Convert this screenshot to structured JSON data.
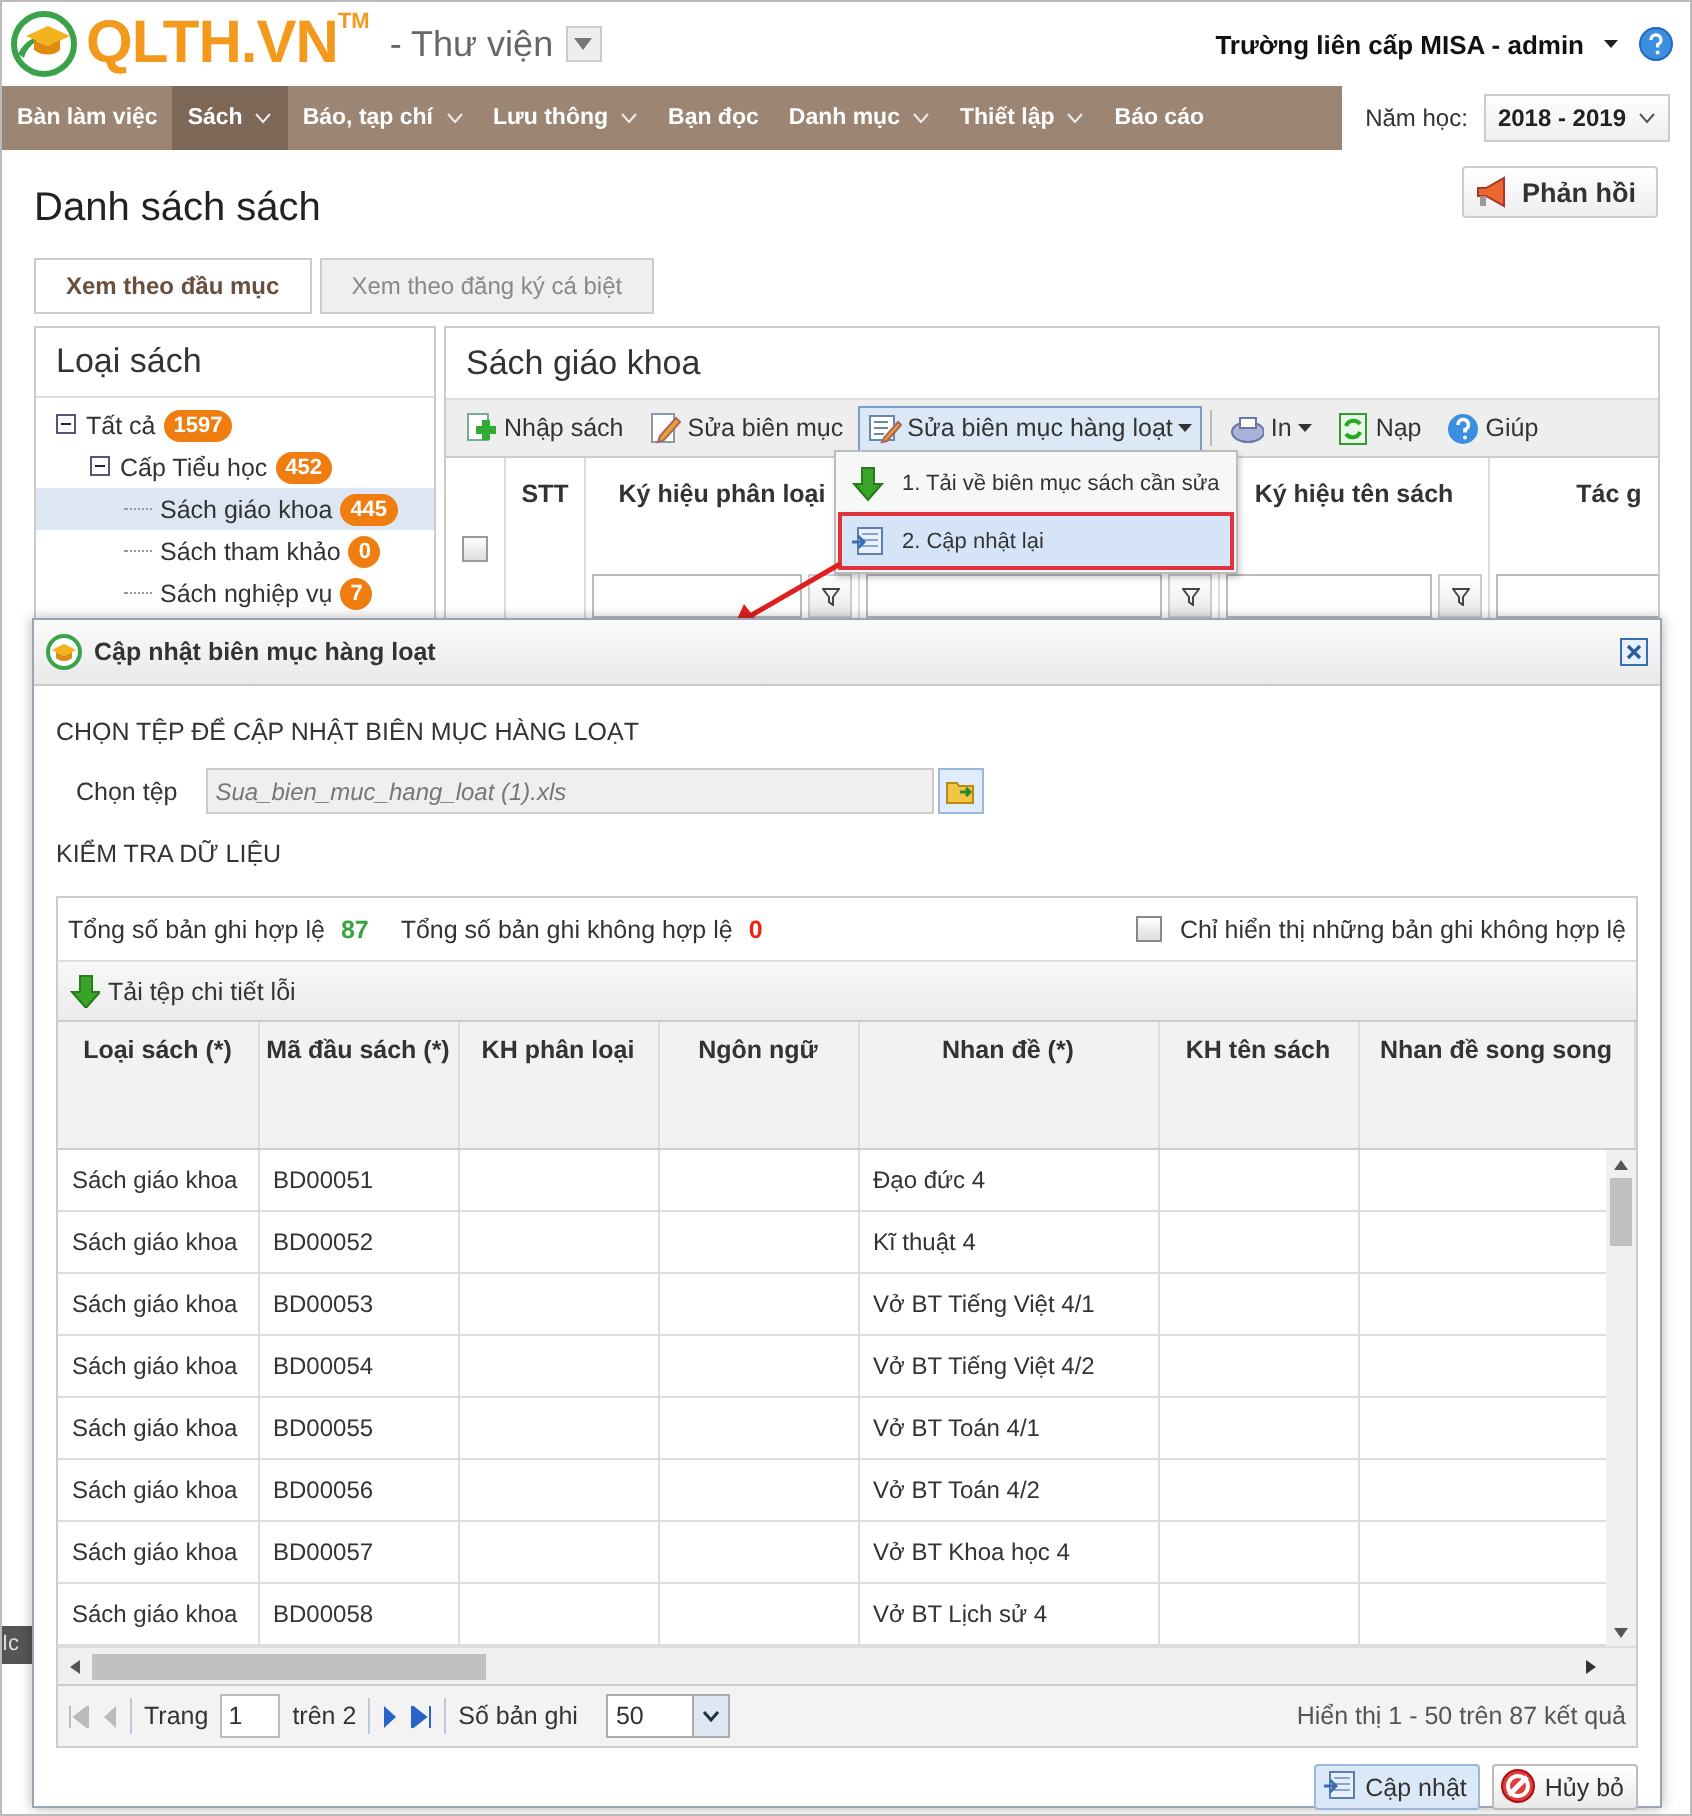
{
  "app": {
    "logo": "QLTH.VN",
    "trademark": "TM",
    "module": "- Thư viện",
    "user": "Trường liên cấp MISA - admin"
  },
  "nav": [
    {
      "label": "Bàn làm việc",
      "has_menu": false,
      "selected": false
    },
    {
      "label": "Sách",
      "has_menu": true,
      "selected": true
    },
    {
      "label": "Báo, tạp chí",
      "has_menu": true,
      "selected": false
    },
    {
      "label": "Lưu thông",
      "has_menu": true,
      "selected": false
    },
    {
      "label": "Bạn đọc",
      "has_menu": false,
      "selected": false
    },
    {
      "label": "Danh mục",
      "has_menu": true,
      "selected": false
    },
    {
      "label": "Thiết lập",
      "has_menu": true,
      "selected": false
    },
    {
      "label": "Báo cáo",
      "has_menu": false,
      "selected": false
    }
  ],
  "school_year": {
    "label": "Năm học:",
    "value": "2018 - 2019"
  },
  "page_title": "Danh sách sách",
  "feedback_button": "Phản hồi",
  "view_tabs": [
    {
      "label": "Xem theo đầu mục",
      "selected": true
    },
    {
      "label": "Xem theo đăng ký cá biệt",
      "selected": false
    }
  ],
  "category_panel": {
    "title": "Loại sách",
    "tree": [
      {
        "label": "Tất cả",
        "count": "1597",
        "expanded": true,
        "selected": false,
        "children": [
          {
            "label": "Cấp Tiểu học",
            "count": "452",
            "expanded": true,
            "selected": false,
            "children": [
              {
                "label": "Sách giáo khoa",
                "count": "445",
                "selected": true
              },
              {
                "label": "Sách tham khảo",
                "count": "0",
                "selected": false
              },
              {
                "label": "Sách nghiệp vụ",
                "count": "7",
                "selected": false
              }
            ]
          }
        ]
      }
    ]
  },
  "books_panel": {
    "title": "Sách giáo khoa",
    "toolbar": [
      {
        "kind": "import",
        "label": "Nhập sách",
        "has_menu": false,
        "open": false
      },
      {
        "kind": "edit",
        "label": "Sửa biên mục",
        "has_menu": false,
        "open": false
      },
      {
        "kind": "batch",
        "label": "Sửa biên mục hàng loạt",
        "has_menu": true,
        "open": true
      },
      {
        "kind": "print",
        "label": "In",
        "has_menu": true,
        "open": false
      },
      {
        "kind": "reload",
        "label": "Nạp",
        "has_menu": false,
        "open": false
      },
      {
        "kind": "help",
        "label": "Giúp",
        "has_menu": false,
        "open": false
      }
    ],
    "select_all": {
      "checked": false
    },
    "columns": [
      {
        "label": "STT",
        "filter": false
      },
      {
        "label": "Ký hiệu phân loại",
        "filter": true
      },
      {
        "filter": true
      },
      {
        "label": "Ký hiệu tên sách",
        "filter": true
      },
      {
        "label": "Tác g",
        "filter": true
      }
    ]
  },
  "batch_menu": [
    {
      "kind": "download",
      "label": "1. Tải về biên mục sách cần sửa",
      "selected": false
    },
    {
      "kind": "update",
      "label": "2. Cập nhật lại",
      "selected": true
    }
  ],
  "side_tag": "Ic",
  "dialog": {
    "title": "Cập nhật biên mục hàng loạt",
    "file_section": "CHỌN TỆP ĐỂ CẬP NHẬT BIÊN MỤC HÀNG LOẠT",
    "file_label": "Chọn tệp",
    "file_value": "Sua_bien_muc_hang_loat (1).xls",
    "check_section": "KIỂM TRA DỮ LIỆU",
    "valid_label": "Tổng số bản ghi hợp lệ",
    "valid_count": "87",
    "invalid_label": "Tổng số bản ghi không hợp lệ",
    "invalid_count": "0",
    "only_invalid": {
      "label": "Chỉ hiển thị những bản ghi không hợp lệ",
      "checked": false
    },
    "download_errors": "Tải tệp chi tiết lỗi",
    "columns": [
      "Loại sách (*)",
      "Mã đầu sách (*)",
      "KH phân loại",
      "Ngôn ngữ",
      "Nhan đề (*)",
      "KH tên sách",
      "Nhan đề song song"
    ],
    "rows": [
      {
        "type": "Sách giáo khoa",
        "code": "BD00051",
        "title": "Đạo đức 4"
      },
      {
        "type": "Sách giáo khoa",
        "code": "BD00052",
        "title": "Kĩ thuật 4"
      },
      {
        "type": "Sách giáo khoa",
        "code": "BD00053",
        "title": "Vở BT Tiếng Việt 4/1"
      },
      {
        "type": "Sách giáo khoa",
        "code": "BD00054",
        "title": "Vở BT Tiếng Việt 4/2"
      },
      {
        "type": "Sách giáo khoa",
        "code": "BD00055",
        "title": "Vở BT Toán 4/1"
      },
      {
        "type": "Sách giáo khoa",
        "code": "BD00056",
        "title": "Vở BT Toán 4/2"
      },
      {
        "type": "Sách giáo khoa",
        "code": "BD00057",
        "title": "Vở BT Khoa học 4"
      },
      {
        "type": "Sách giáo khoa",
        "code": "BD00058",
        "title": "Vở BT Lịch sử 4"
      }
    ],
    "pager": {
      "page_label": "Trang",
      "page": "1",
      "of": "trên 2",
      "size_label": "Số bản ghi",
      "size": "50",
      "summary": "Hiển thị 1 - 50 trên 87 kết quả"
    },
    "buttons": [
      {
        "kind": "update",
        "label": "Cập nhật"
      },
      {
        "kind": "cancel",
        "label": "Hủy bỏ"
      }
    ]
  }
}
